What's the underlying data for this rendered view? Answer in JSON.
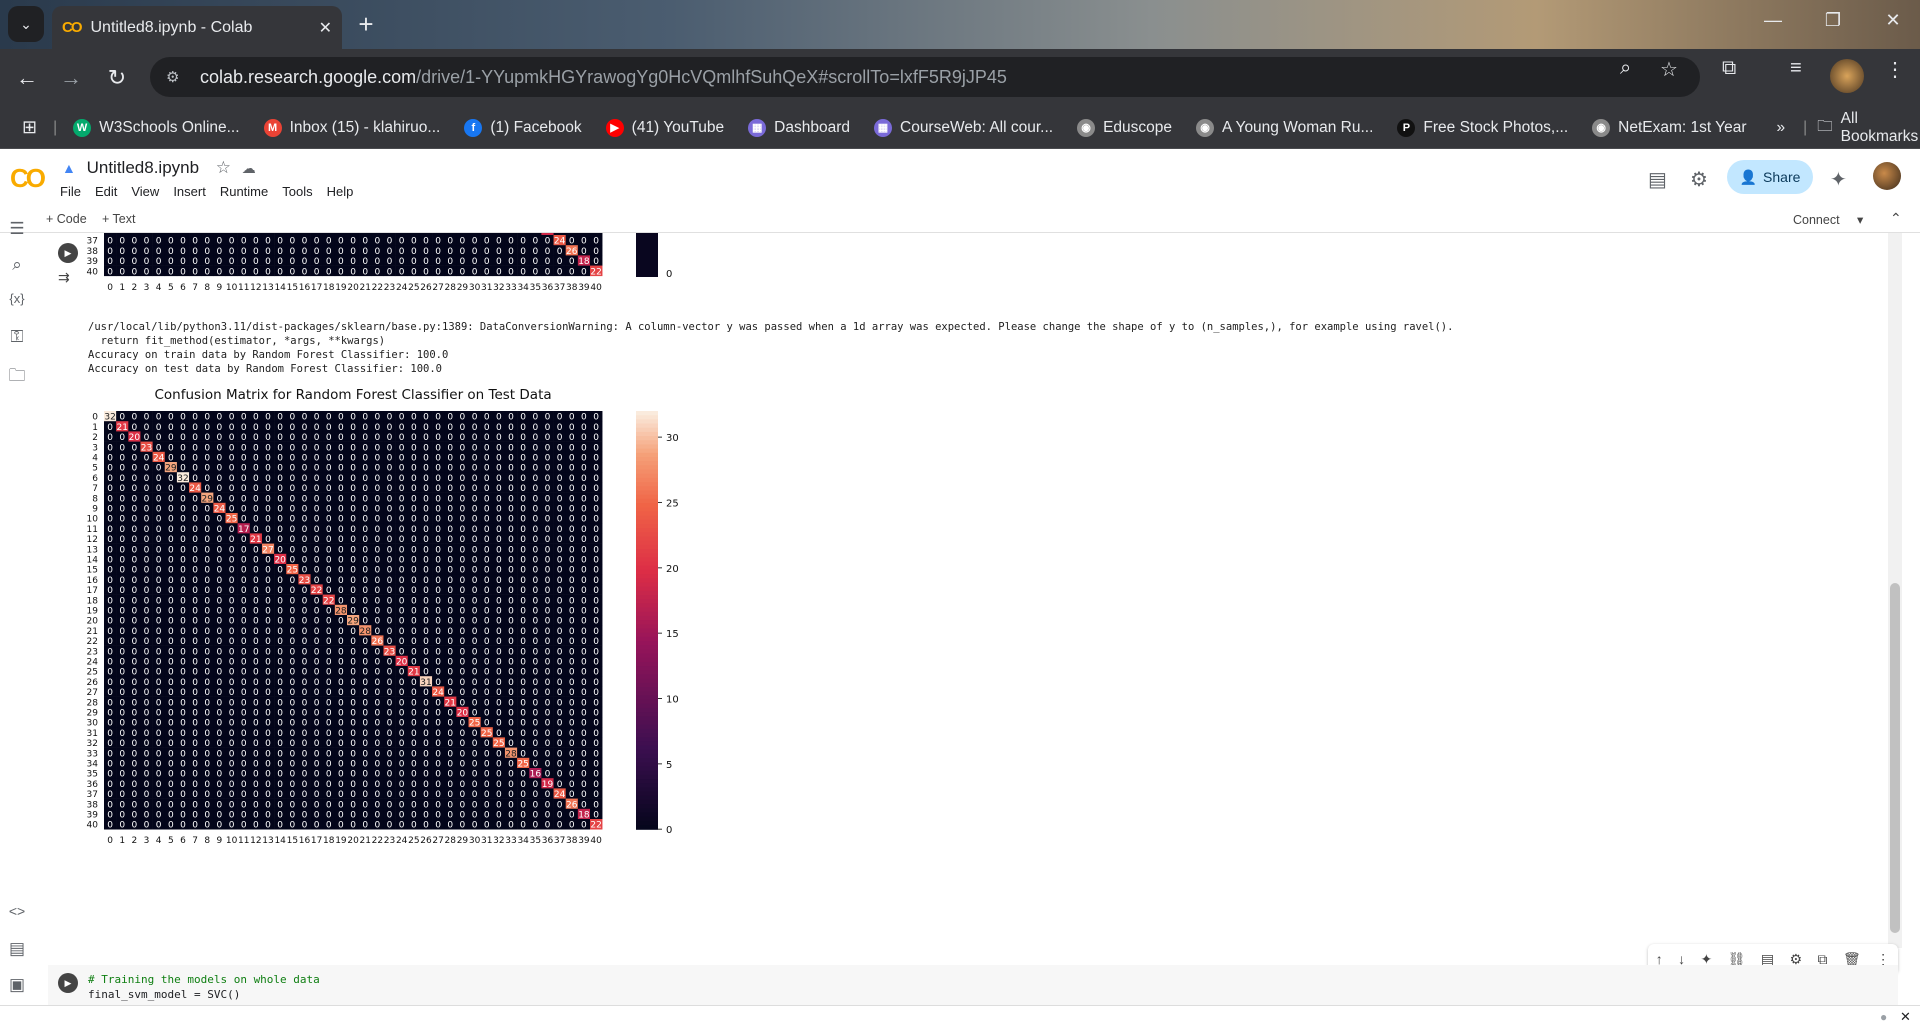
{
  "browser": {
    "tab_title": "Untitled8.ipynb - Colab",
    "tab_icon": "CO",
    "url_host": "colab.research.google.com",
    "url_path": "/drive/1-YYupmkHGYrawogYg0HcVQmlhfSuhQeX#scrollTo=lxfF5R9jJP45",
    "bookmarks": [
      {
        "label": "W3Schools Online...",
        "icon": "w3schools-icon",
        "color": "#04aa6d",
        "glyph": "W"
      },
      {
        "label": "Inbox (15) - klahiruo...",
        "icon": "gmail-icon",
        "color": "#ea4335",
        "glyph": "M"
      },
      {
        "label": "(1) Facebook",
        "icon": "facebook-icon",
        "color": "#1877f2",
        "glyph": "f"
      },
      {
        "label": "(41) YouTube",
        "icon": "youtube-icon",
        "color": "#ff0000",
        "glyph": "▶"
      },
      {
        "label": "Dashboard",
        "icon": "university-icon",
        "color": "#7a6ad8",
        "glyph": "▦"
      },
      {
        "label": "CourseWeb: All cour...",
        "icon": "university-icon",
        "color": "#7a6ad8",
        "glyph": "▦"
      },
      {
        "label": "Eduscope",
        "icon": "globe-icon",
        "color": "#8a8a8a",
        "glyph": "◉"
      },
      {
        "label": "A Young Woman Ru...",
        "icon": "globe-icon",
        "color": "#8a8a8a",
        "glyph": "◉"
      },
      {
        "label": "Free Stock Photos,...",
        "icon": "pexels-icon",
        "color": "#111111",
        "glyph": "P"
      },
      {
        "label": "NetExam: 1st Year",
        "icon": "globe-icon",
        "color": "#8a8a8a",
        "glyph": "◉"
      }
    ],
    "more_bookmarks": "»",
    "all_bookmarks": "All Bookmarks"
  },
  "colab": {
    "notebook_title": "Untitled8.ipynb",
    "menus": [
      "File",
      "Edit",
      "View",
      "Insert",
      "Runtime",
      "Tools",
      "Help"
    ],
    "share_label": "Share",
    "add_code": "+ Code",
    "add_text": "+ Text",
    "connect_label": "Connect"
  },
  "output": {
    "warning_line1": "/usr/local/lib/python3.11/dist-packages/sklearn/base.py:1389: DataConversionWarning: A column-vector y was passed when a 1d array was expected. Please change the shape of y to (n_samples,), for example using ravel().",
    "warning_line2": "  return fit_method(estimator, *args, **kwargs)",
    "train_acc": "Accuracy on train data by Random Forest Classifier: 100.0",
    "test_acc": "Accuracy on test data by Random Forest Classifier: 100.0"
  },
  "code_cell": {
    "line1": "# Training the models on whole data",
    "line2": "final_svm_model = SVC()"
  },
  "chart_data": [
    {
      "type": "heatmap",
      "title": "",
      "note": "partially visible (cropped at top), rows 37-40 shown",
      "rows_visible": [
        "37",
        "38",
        "39",
        "40"
      ],
      "columns": [
        "0",
        "1",
        "2",
        "3",
        "4",
        "5",
        "6",
        "7",
        "8",
        "9",
        "10",
        "11",
        "12",
        "13",
        "14",
        "15",
        "16",
        "17",
        "18",
        "19",
        "20",
        "21",
        "22",
        "23",
        "24",
        "25",
        "26",
        "27",
        "28",
        "29",
        "30",
        "31",
        "32",
        "33",
        "34",
        "35",
        "36",
        "37",
        "38",
        "39",
        "40"
      ],
      "diagonal_values_visible": {
        "37": 24,
        "38": 26,
        "39": 18,
        "40": 22
      },
      "colorbar_min_tick": "0"
    },
    {
      "type": "heatmap",
      "title": "Confusion Matrix for Random Forest Classifier on Test Data",
      "rows": [
        "0",
        "1",
        "2",
        "3",
        "4",
        "5",
        "6",
        "7",
        "8",
        "9",
        "10",
        "11",
        "12",
        "13",
        "14",
        "15",
        "16",
        "17",
        "18",
        "19",
        "20",
        "21",
        "22",
        "23",
        "24",
        "25",
        "26",
        "27",
        "28",
        "29",
        "30",
        "31",
        "32",
        "33",
        "34",
        "35",
        "36",
        "37",
        "38",
        "39",
        "40"
      ],
      "columns": [
        "0",
        "1",
        "2",
        "3",
        "4",
        "5",
        "6",
        "7",
        "8",
        "9",
        "10",
        "11",
        "12",
        "13",
        "14",
        "15",
        "16",
        "17",
        "18",
        "19",
        "20",
        "21",
        "22",
        "23",
        "24",
        "25",
        "26",
        "27",
        "28",
        "29",
        "30",
        "31",
        "32",
        "33",
        "34",
        "35",
        "36",
        "37",
        "38",
        "39",
        "40"
      ],
      "diagonal": [
        32,
        21,
        20,
        23,
        24,
        29,
        32,
        24,
        29,
        24,
        25,
        17,
        21,
        27,
        20,
        25,
        23,
        22,
        22,
        28,
        29,
        28,
        26,
        23,
        20,
        21,
        31,
        24,
        21,
        20,
        25,
        25,
        25,
        28,
        25,
        16,
        19,
        24,
        26,
        18,
        22
      ],
      "off_diagonal_value": 0,
      "colorbar_ticks": [
        "0",
        "5",
        "10",
        "15",
        "20",
        "25",
        "30"
      ],
      "colorbar_range": [
        0,
        32
      ]
    }
  ]
}
